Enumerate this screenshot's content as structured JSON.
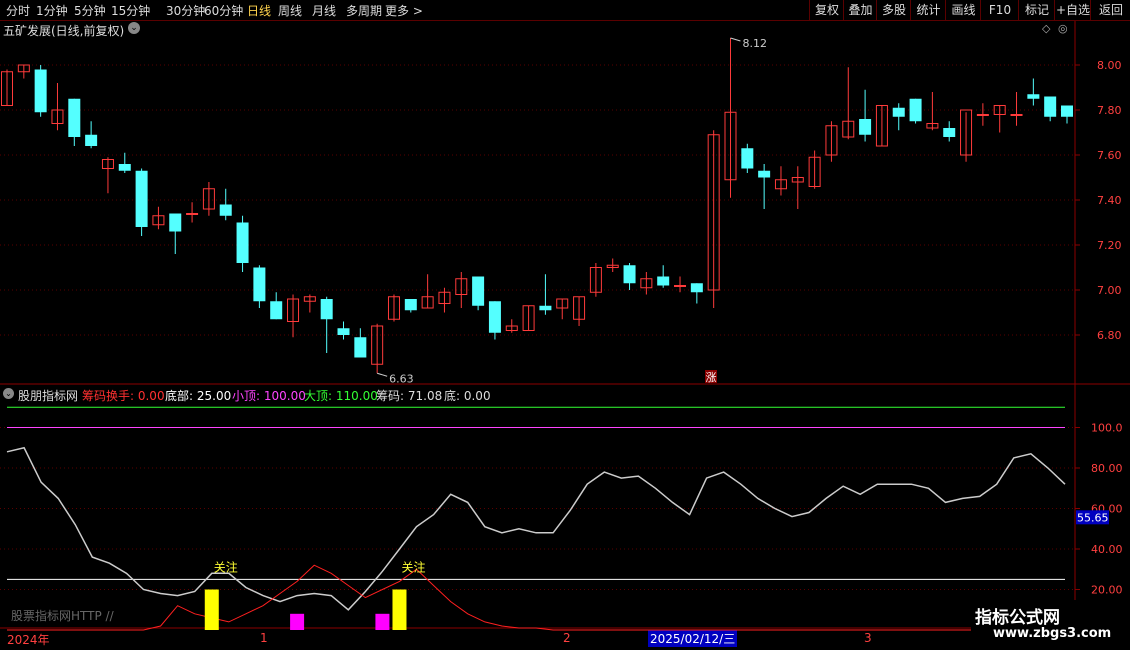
{
  "toolbar": {
    "periods": [
      "分时",
      "1分钟",
      "5分钟",
      "15分钟",
      "30分钟",
      "60分钟",
      "日线",
      "周线",
      "月线",
      "多周期",
      "更多 >"
    ],
    "active_period": "日线",
    "right_buttons": [
      "复权",
      "叠加",
      "多股",
      "统计",
      "画线",
      "F10",
      "标记",
      "+自选",
      "返回"
    ]
  },
  "main_chart": {
    "title": "五矿发展(日线,前复权)",
    "high_label": "8.12",
    "low_label": "6.63",
    "zhang_badge": "涨",
    "y_ticks": [
      "8.00",
      "7.80",
      "7.60",
      "7.40",
      "7.20",
      "7.00",
      "6.80"
    ],
    "colors": {
      "up": "#ff3b3b",
      "down": "#54ffff",
      "grid": "#5a0000"
    }
  },
  "indicator": {
    "name": "股朋指标网",
    "params": [
      {
        "label": "筹码换手:",
        "value": "0.00",
        "color": "#ff3030"
      },
      {
        "label": "底部:",
        "value": "25.00",
        "color": "#ffffff"
      },
      {
        "label": "小顶:",
        "value": "100.00",
        "color": "#ff44ff"
      },
      {
        "label": "大顶:",
        "value": "110.00",
        "color": "#33ff33"
      },
      {
        "label": "筹码:",
        "value": "71.08",
        "color": "#dddddd"
      },
      {
        "label": "底:",
        "value": "0.00",
        "color": "#dddddd"
      }
    ],
    "y_ticks": [
      "100.0",
      "80.00",
      "60.00",
      "40.00",
      "20.00"
    ],
    "current_value": "55.65",
    "guanzhu_labels": [
      "关注",
      "关注"
    ],
    "source_text": "股票指标网HTTP //"
  },
  "time_axis": {
    "labels": [
      "2024年",
      "1",
      "2",
      "3"
    ],
    "cursor_date": "2025/02/12/三"
  },
  "watermark": {
    "main": "指标公式网",
    "url": "www.zbgs3.com"
  },
  "chart_data": [
    {
      "type": "candlestick",
      "title": "五矿发展(日线,前复权)",
      "ylim": [
        6.6,
        8.2
      ],
      "candles": [
        {
          "o": 7.82,
          "h": 7.98,
          "l": 7.82,
          "c": 7.97
        },
        {
          "o": 7.97,
          "h": 8.0,
          "l": 7.94,
          "c": 8.0
        },
        {
          "o": 7.98,
          "h": 8.0,
          "l": 7.77,
          "c": 7.79
        },
        {
          "o": 7.74,
          "h": 7.92,
          "l": 7.71,
          "c": 7.8
        },
        {
          "o": 7.85,
          "h": 7.85,
          "l": 7.64,
          "c": 7.68
        },
        {
          "o": 7.69,
          "h": 7.75,
          "l": 7.63,
          "c": 7.64
        },
        {
          "o": 7.54,
          "h": 7.59,
          "l": 7.43,
          "c": 7.58
        },
        {
          "o": 7.56,
          "h": 7.61,
          "l": 7.52,
          "c": 7.53
        },
        {
          "o": 7.53,
          "h": 7.54,
          "l": 7.24,
          "c": 7.28
        },
        {
          "o": 7.29,
          "h": 7.37,
          "l": 7.27,
          "c": 7.33
        },
        {
          "o": 7.34,
          "h": 7.34,
          "l": 7.16,
          "c": 7.26
        },
        {
          "o": 7.34,
          "h": 7.39,
          "l": 7.3,
          "c": 7.34
        },
        {
          "o": 7.36,
          "h": 7.48,
          "l": 7.33,
          "c": 7.45
        },
        {
          "o": 7.38,
          "h": 7.45,
          "l": 7.31,
          "c": 7.33
        },
        {
          "o": 7.3,
          "h": 7.33,
          "l": 7.08,
          "c": 7.12
        },
        {
          "o": 7.1,
          "h": 7.11,
          "l": 6.92,
          "c": 6.95
        },
        {
          "o": 6.95,
          "h": 6.99,
          "l": 6.87,
          "c": 6.87
        },
        {
          "o": 6.86,
          "h": 6.98,
          "l": 6.79,
          "c": 6.96
        },
        {
          "o": 6.95,
          "h": 6.98,
          "l": 6.9,
          "c": 6.97
        },
        {
          "o": 6.96,
          "h": 6.97,
          "l": 6.72,
          "c": 6.87
        },
        {
          "o": 6.83,
          "h": 6.86,
          "l": 6.78,
          "c": 6.8
        },
        {
          "o": 6.79,
          "h": 6.83,
          "l": 6.7,
          "c": 6.7
        },
        {
          "o": 6.67,
          "h": 6.85,
          "l": 6.63,
          "c": 6.84
        },
        {
          "o": 6.87,
          "h": 6.98,
          "l": 6.86,
          "c": 6.97
        },
        {
          "o": 6.96,
          "h": 6.96,
          "l": 6.9,
          "c": 6.91
        },
        {
          "o": 6.92,
          "h": 7.07,
          "l": 6.92,
          "c": 6.97
        },
        {
          "o": 6.94,
          "h": 7.01,
          "l": 6.9,
          "c": 6.99
        },
        {
          "o": 6.98,
          "h": 7.08,
          "l": 6.92,
          "c": 7.05
        },
        {
          "o": 7.06,
          "h": 7.06,
          "l": 6.91,
          "c": 6.93
        },
        {
          "o": 6.95,
          "h": 6.95,
          "l": 6.78,
          "c": 6.81
        },
        {
          "o": 6.82,
          "h": 6.87,
          "l": 6.81,
          "c": 6.84
        },
        {
          "o": 6.82,
          "h": 6.93,
          "l": 6.82,
          "c": 6.93
        },
        {
          "o": 6.93,
          "h": 7.07,
          "l": 6.89,
          "c": 6.91
        },
        {
          "o": 6.92,
          "h": 6.96,
          "l": 6.87,
          "c": 6.96
        },
        {
          "o": 6.87,
          "h": 6.97,
          "l": 6.84,
          "c": 6.97
        },
        {
          "o": 6.99,
          "h": 7.12,
          "l": 6.97,
          "c": 7.1
        },
        {
          "o": 7.1,
          "h": 7.14,
          "l": 7.08,
          "c": 7.11
        },
        {
          "o": 7.11,
          "h": 7.12,
          "l": 7.0,
          "c": 7.03
        },
        {
          "o": 7.01,
          "h": 7.08,
          "l": 6.98,
          "c": 7.05
        },
        {
          "o": 7.06,
          "h": 7.11,
          "l": 7.01,
          "c": 7.02
        },
        {
          "o": 7.02,
          "h": 7.06,
          "l": 6.99,
          "c": 7.02
        },
        {
          "o": 7.03,
          "h": 7.03,
          "l": 6.94,
          "c": 6.99
        },
        {
          "o": 7.0,
          "h": 7.71,
          "l": 6.92,
          "c": 7.69
        },
        {
          "o": 7.49,
          "h": 8.12,
          "l": 7.41,
          "c": 7.79
        },
        {
          "o": 7.63,
          "h": 7.65,
          "l": 7.52,
          "c": 7.54
        },
        {
          "o": 7.53,
          "h": 7.56,
          "l": 7.36,
          "c": 7.5
        },
        {
          "o": 7.45,
          "h": 7.55,
          "l": 7.42,
          "c": 7.49
        },
        {
          "o": 7.48,
          "h": 7.55,
          "l": 7.36,
          "c": 7.5
        },
        {
          "o": 7.46,
          "h": 7.62,
          "l": 7.45,
          "c": 7.59
        },
        {
          "o": 7.6,
          "h": 7.75,
          "l": 7.57,
          "c": 7.73
        },
        {
          "o": 7.68,
          "h": 7.99,
          "l": 7.67,
          "c": 7.75
        },
        {
          "o": 7.76,
          "h": 7.89,
          "l": 7.66,
          "c": 7.69
        },
        {
          "o": 7.64,
          "h": 7.82,
          "l": 7.64,
          "c": 7.82
        },
        {
          "o": 7.81,
          "h": 7.83,
          "l": 7.71,
          "c": 7.77
        },
        {
          "o": 7.85,
          "h": 7.85,
          "l": 7.74,
          "c": 7.75
        },
        {
          "o": 7.72,
          "h": 7.88,
          "l": 7.71,
          "c": 7.74
        },
        {
          "o": 7.72,
          "h": 7.75,
          "l": 7.66,
          "c": 7.68
        },
        {
          "o": 7.6,
          "h": 7.79,
          "l": 7.57,
          "c": 7.8
        },
        {
          "o": 7.78,
          "h": 7.83,
          "l": 7.73,
          "c": 7.78
        },
        {
          "o": 7.78,
          "h": 7.82,
          "l": 7.7,
          "c": 7.82
        },
        {
          "o": 7.78,
          "h": 7.88,
          "l": 7.73,
          "c": 7.78
        },
        {
          "o": 7.87,
          "h": 7.94,
          "l": 7.82,
          "c": 7.85
        },
        {
          "o": 7.86,
          "h": 7.86,
          "l": 7.75,
          "c": 7.77
        },
        {
          "o": 7.82,
          "h": 7.82,
          "l": 7.74,
          "c": 7.77
        }
      ]
    },
    {
      "type": "line",
      "title": "股朋指标网",
      "ylim": [
        0,
        120
      ],
      "horizontal_lines": [
        {
          "name": "大顶",
          "y": 110,
          "color": "#33ff33"
        },
        {
          "name": "小顶",
          "y": 100,
          "color": "#ff44ff"
        },
        {
          "name": "底部",
          "y": 25,
          "color": "#ffffff"
        }
      ],
      "series": [
        {
          "name": "筹码",
          "color": "#cccccc",
          "values": [
            88,
            90,
            73,
            65,
            52,
            36,
            33,
            28,
            20,
            18,
            17,
            19,
            28,
            28,
            21,
            17,
            14,
            17,
            18,
            17,
            10,
            19,
            29,
            40,
            51,
            57,
            67,
            63,
            51,
            48,
            50,
            48,
            48,
            59,
            72,
            78,
            75,
            76,
            70,
            63,
            57,
            75,
            78,
            72,
            65,
            60,
            56,
            58,
            65,
            71,
            67,
            72,
            72,
            72,
            70,
            63,
            65,
            66,
            72,
            85,
            87,
            80,
            72
          ]
        },
        {
          "name": "筹码换手",
          "color": "#ff2020",
          "values": [
            0,
            0,
            0,
            0,
            0,
            0,
            0,
            0,
            0,
            2,
            12,
            8,
            6,
            4,
            8,
            12,
            18,
            24,
            32,
            28,
            22,
            16,
            20,
            24,
            30,
            22,
            14,
            8,
            4,
            2,
            1,
            1,
            0,
            0,
            0,
            0,
            0,
            0,
            0,
            0,
            0,
            0,
            0,
            0,
            0,
            0,
            0,
            0,
            0,
            0,
            0,
            0,
            0,
            0,
            0,
            0,
            0,
            0,
            0,
            0,
            0,
            0,
            0
          ]
        }
      ],
      "bars": [
        {
          "x_index": 12,
          "value": 20,
          "color": "#ffff00"
        },
        {
          "x_index": 17,
          "value": 8,
          "color": "#ff00ff"
        },
        {
          "x_index": 22,
          "value": 8,
          "color": "#ff00ff"
        },
        {
          "x_index": 23,
          "value": 20,
          "color": "#ffff00"
        }
      ],
      "current_value": 55.65
    }
  ]
}
